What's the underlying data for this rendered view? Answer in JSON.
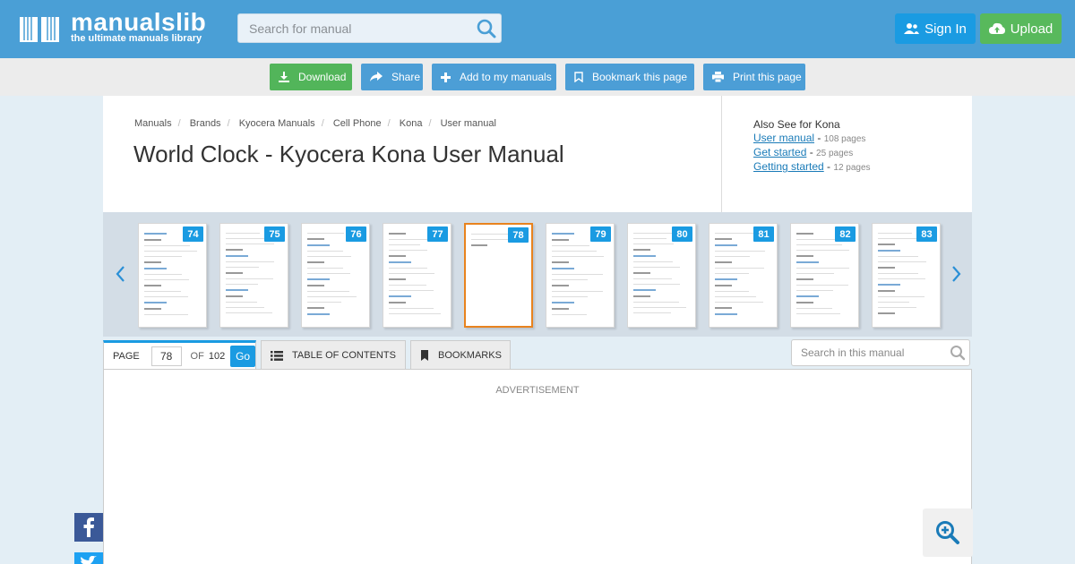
{
  "header": {
    "logo_text": "manualslib",
    "logo_tagline": "the ultimate manuals library",
    "search_placeholder": "Search for manual",
    "sign_in": "Sign In",
    "upload": "Upload"
  },
  "toolbar": {
    "download": "Download",
    "share": "Share",
    "add": "Add to my manuals",
    "bookmark": "Bookmark this page",
    "print": "Print this page"
  },
  "breadcrumb": [
    "Manuals",
    "Brands",
    "Kyocera Manuals",
    "Cell Phone",
    "Kona",
    "User manual"
  ],
  "page_title": "World Clock - Kyocera Kona User Manual",
  "also_see": {
    "heading": "Also See for Kona",
    "items": [
      {
        "label": "User manual",
        "pages": "108 pages"
      },
      {
        "label": "Get started",
        "pages": "25 pages"
      },
      {
        "label": "Getting started",
        "pages": "12 pages"
      }
    ]
  },
  "thumbnails": [
    "74",
    "75",
    "76",
    "77",
    "78",
    "79",
    "80",
    "81",
    "82",
    "83"
  ],
  "active_page": "78",
  "pager": {
    "page_label": "PAGE",
    "current": "78",
    "of_label": "OF",
    "total": "102",
    "go": "Go"
  },
  "tabs": {
    "toc": "TABLE OF CONTENTS",
    "bookmarks": "BOOKMARKS"
  },
  "manual_search_placeholder": "Search in this manual",
  "advertisement": "ADVERTISEMENT",
  "colors": {
    "header": "#4a9fd6",
    "accent": "#1a9be2",
    "green": "#58b95c",
    "active_thumb": "#e8831e"
  }
}
